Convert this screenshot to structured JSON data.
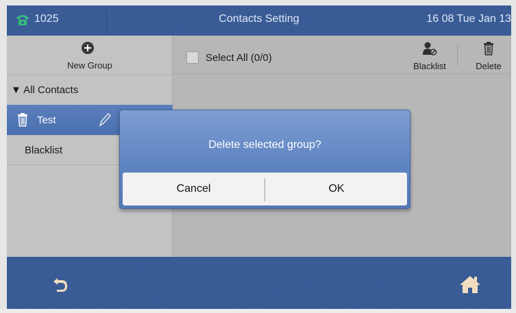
{
  "status_bar": {
    "extension": "1025",
    "title": "Contacts Setting",
    "clock": "16 08 Tue Jan 13",
    "phone_icon": "phone-icon"
  },
  "sidebar": {
    "new_group_label": "New Group",
    "new_group_icon": "plus-circle-icon",
    "all_contacts_label": "▼ All Contacts",
    "items": [
      {
        "label": "Test",
        "selected": true,
        "icons": [
          "trash-icon",
          "pencil-icon"
        ]
      },
      {
        "label": "Blacklist",
        "selected": false
      }
    ]
  },
  "main": {
    "select_all_label": "Select All (0/0)",
    "toolbar": {
      "blacklist_label": "Blacklist",
      "blacklist_icon": "person-blocked-icon",
      "delete_label": "Delete",
      "delete_icon": "trash-icon"
    }
  },
  "dialog": {
    "message": "Delete selected group?",
    "cancel_label": "Cancel",
    "ok_label": "OK"
  },
  "bottom_bar": {
    "back_icon": "back-icon",
    "home_icon": "home-icon"
  },
  "colors": {
    "bar_blue": "#3c5f9a",
    "selected_row": "#5b7fbd",
    "dialog_top": "#7f9ed2",
    "dialog_bottom": "#5478b6",
    "panel_gray": "#b7b7b7"
  }
}
